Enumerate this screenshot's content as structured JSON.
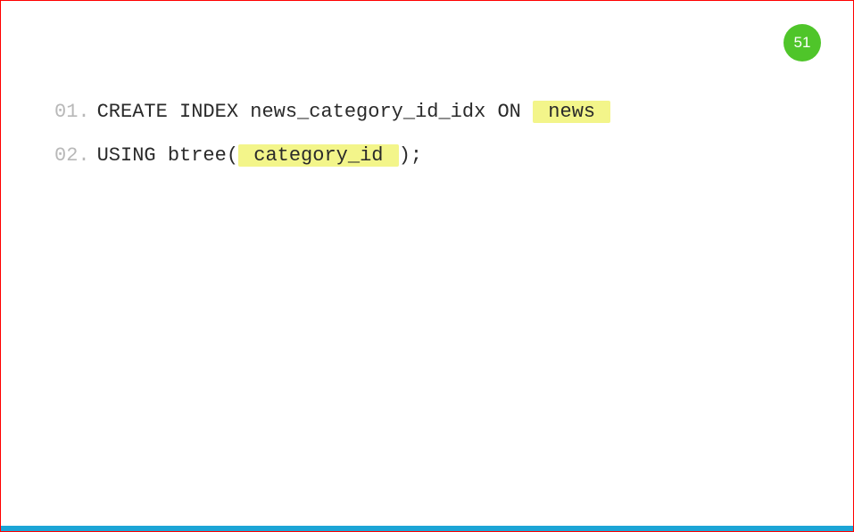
{
  "page_number": "51",
  "code": {
    "lines": [
      {
        "number": "01.",
        "segments": [
          {
            "text": "CREATE INDEX news_category_id_idx ON ",
            "highlight": false
          },
          {
            "text": " news ",
            "highlight": true
          }
        ]
      },
      {
        "number": "02.",
        "segments": [
          {
            "text": "USING btree(",
            "highlight": false
          },
          {
            "text": " category_id ",
            "highlight": true
          },
          {
            "text": ");",
            "highlight": false
          }
        ]
      }
    ]
  }
}
